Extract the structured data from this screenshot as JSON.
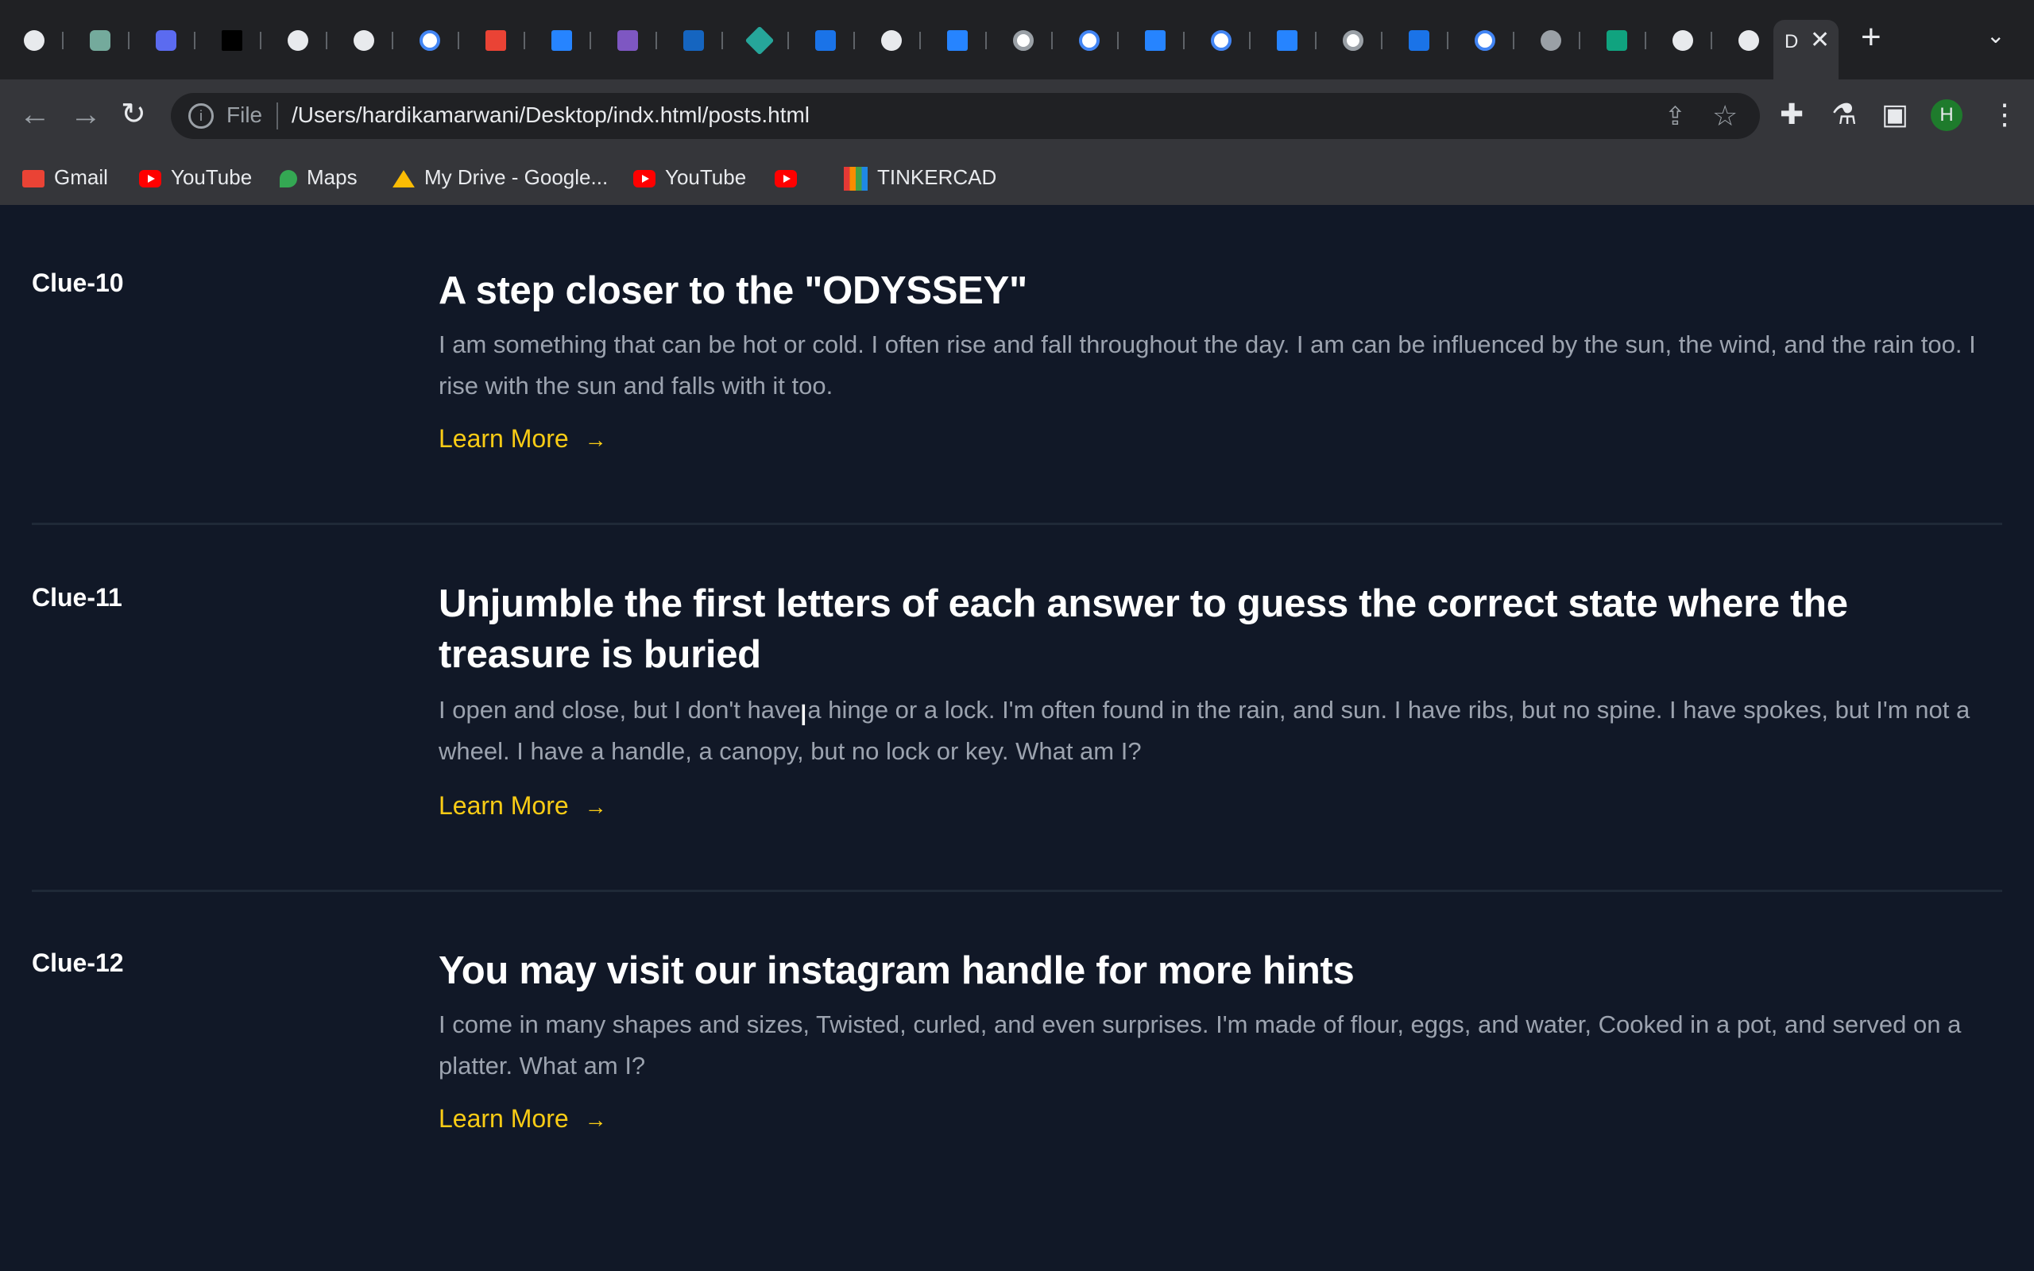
{
  "browser": {
    "active_tab_label": "D",
    "url_scheme_label": "File",
    "url": "/Users/hardikamarwani/Desktop/indx.html/posts.html",
    "profile_initial": "H",
    "bookmarks": [
      "Gmail",
      "YouTube",
      "Maps",
      "My Drive - Google...",
      "YouTube",
      "",
      "TINKERCAD"
    ]
  },
  "posts": [
    {
      "label": "Clue-10",
      "title": "A step closer to the \"ODYSSEY\"",
      "description": "I am something that can be hot or cold. I often rise and fall throughout the day. I am can be influenced by the sun, the wind, and the rain too. I rise with the sun and falls with it too.",
      "link": "Learn More"
    },
    {
      "label": "Clue-11",
      "title": "Unjumble the first letters of each answer to guess the correct state where the treasure is buried",
      "description": "I open and close, but I don't have a hinge or a lock. I'm often found in the rain, and sun. I have ribs, but no spine. I have spokes, but I'm not a wheel. I have a handle, a canopy, but no lock or key. What am I?",
      "link": "Learn More"
    },
    {
      "label": "Clue-12",
      "title": "You may visit our instagram handle for more hints",
      "description": "I come in many shapes and sizes, Twisted, curled, and even surprises. I'm made of flour, eggs, and water, Cooked in a pot, and served on a platter. What am I?",
      "link": "Learn More"
    }
  ],
  "colors": {
    "background": "#111827",
    "link": "#facc15",
    "muted_text": "#9ca3af"
  }
}
